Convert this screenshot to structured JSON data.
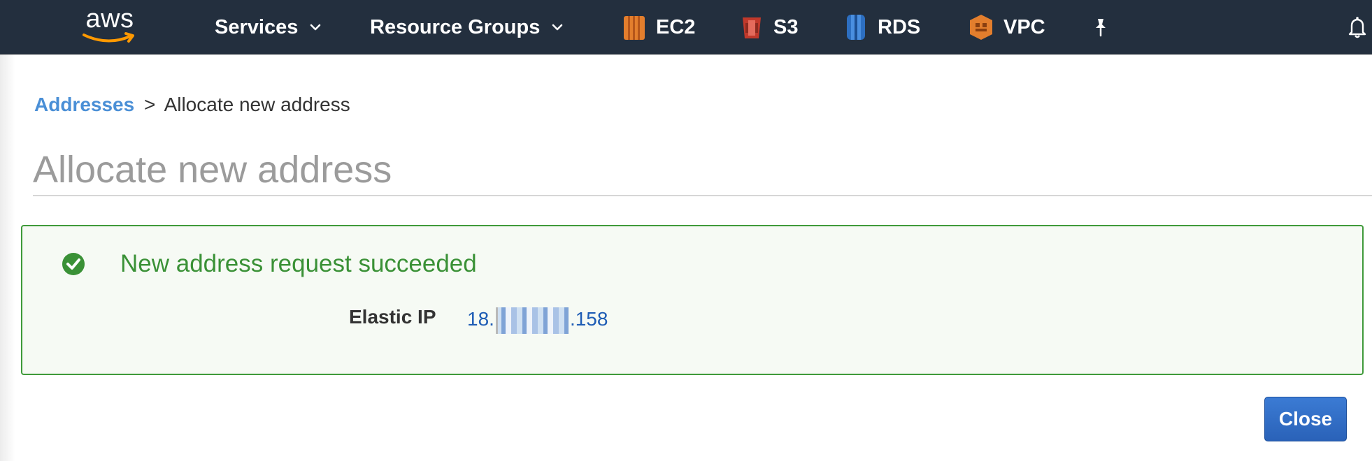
{
  "topnav": {
    "logo_text": "aws",
    "services_label": "Services",
    "resource_groups_label": "Resource Groups",
    "shortcuts": [
      {
        "label": "EC2",
        "icon": "ec2-icon",
        "color": "#e37e2d"
      },
      {
        "label": "S3",
        "icon": "s3-icon",
        "color": "#c1392b"
      },
      {
        "label": "RDS",
        "icon": "rds-icon",
        "color": "#2d6fc1"
      },
      {
        "label": "VPC",
        "icon": "vpc-icon",
        "color": "#e37e2d"
      }
    ],
    "pin_icon": "pin-icon",
    "bell_icon": "bell-icon"
  },
  "breadcrumb": {
    "link_label": "Addresses",
    "separator": ">",
    "current": "Allocate new address"
  },
  "page": {
    "title": "Allocate new address"
  },
  "alert": {
    "icon": "check-circle-icon",
    "title": "New address request succeeded",
    "elastic_ip_label": "Elastic IP",
    "elastic_ip_prefix": "18.",
    "elastic_ip_suffix": ".158"
  },
  "actions": {
    "close_label": "Close"
  },
  "colors": {
    "nav_bg": "#232f3e",
    "link": "#4a8fd6",
    "success": "#3a9136",
    "primary_button": "#2a62b8"
  }
}
